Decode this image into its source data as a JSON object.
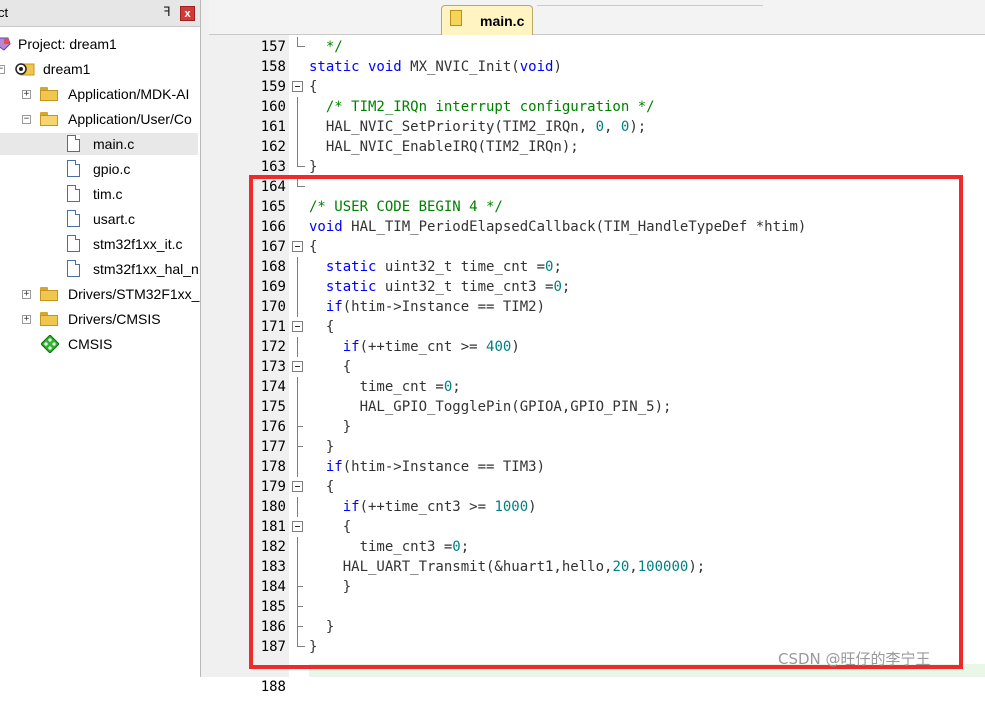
{
  "project_panel": {
    "title": "ct",
    "pin_glyph": "ꟻ",
    "close_glyph": "x",
    "tree": [
      {
        "label": "Project: dream1",
        "icon": "project-icon"
      },
      {
        "label": "dream1",
        "icon": "target-icon",
        "expander": "−"
      },
      {
        "label": "Application/MDK-AI",
        "icon": "folder-icon",
        "expander": "+"
      },
      {
        "label": "Application/User/Co",
        "icon": "folder-open-icon",
        "expander": "−"
      },
      {
        "label": "main.c",
        "icon": "file-icon"
      },
      {
        "label": "gpio.c",
        "icon": "file-icon"
      },
      {
        "label": "tim.c",
        "icon": "file-icon"
      },
      {
        "label": "usart.c",
        "icon": "file-icon"
      },
      {
        "label": "stm32f1xx_it.c",
        "icon": "file-icon"
      },
      {
        "label": "stm32f1xx_hal_n",
        "icon": "file-icon"
      },
      {
        "label": "Drivers/STM32F1xx_",
        "icon": "folder-icon",
        "expander": "+"
      },
      {
        "label": "Drivers/CMSIS",
        "icon": "folder-icon",
        "expander": "+"
      },
      {
        "label": "CMSIS",
        "icon": "cmsis-diamond-icon"
      }
    ]
  },
  "editor": {
    "active_tab": "main.c",
    "lines": [
      {
        "n": "157",
        "fold": "end"
      },
      {
        "n": "158",
        "fold": ""
      },
      {
        "n": "159",
        "fold": "box"
      },
      {
        "n": "160",
        "fold": "line"
      },
      {
        "n": "161",
        "fold": "line"
      },
      {
        "n": "162",
        "fold": "line"
      },
      {
        "n": "163",
        "fold": "end"
      },
      {
        "n": "164",
        "fold": "end"
      },
      {
        "n": "165",
        "fold": ""
      },
      {
        "n": "166",
        "fold": ""
      },
      {
        "n": "167",
        "fold": "box"
      },
      {
        "n": "168",
        "fold": "line"
      },
      {
        "n": "169",
        "fold": "line"
      },
      {
        "n": "170",
        "fold": "line"
      },
      {
        "n": "171",
        "fold": "box"
      },
      {
        "n": "172",
        "fold": "line"
      },
      {
        "n": "173",
        "fold": "box"
      },
      {
        "n": "174",
        "fold": "line"
      },
      {
        "n": "175",
        "fold": "line"
      },
      {
        "n": "176",
        "fold": "tick"
      },
      {
        "n": "177",
        "fold": "tick"
      },
      {
        "n": "178",
        "fold": "line"
      },
      {
        "n": "179",
        "fold": "box"
      },
      {
        "n": "180",
        "fold": "line"
      },
      {
        "n": "181",
        "fold": "box"
      },
      {
        "n": "182",
        "fold": "line"
      },
      {
        "n": "183",
        "fold": "line"
      },
      {
        "n": "184",
        "fold": "tick"
      },
      {
        "n": "185",
        "fold": "tick"
      },
      {
        "n": "186",
        "fold": "tick"
      },
      {
        "n": "187",
        "fold": "end"
      }
    ],
    "code": [
      [
        {
          "t": "  */",
          "c": "cm"
        }
      ],
      [
        {
          "t": "static void",
          "c": "kw"
        },
        {
          "t": " MX_NVIC_Init("
        },
        {
          "t": "void",
          "c": "kw"
        },
        {
          "t": ")"
        }
      ],
      [
        {
          "t": "{"
        }
      ],
      [
        {
          "t": "  "
        },
        {
          "t": "/* TIM2_IRQn interrupt configuration */",
          "c": "cm"
        }
      ],
      [
        {
          "t": "  HAL_NVIC_SetPriority(TIM2_IRQn, "
        },
        {
          "t": "0",
          "c": "num"
        },
        {
          "t": ", "
        },
        {
          "t": "0",
          "c": "num"
        },
        {
          "t": ");"
        }
      ],
      [
        {
          "t": "  HAL_NVIC_EnableIRQ(TIM2_IRQn);"
        }
      ],
      [
        {
          "t": "}"
        }
      ],
      [
        {
          "t": ""
        }
      ],
      [
        {
          "t": "/* USER CODE BEGIN 4 */",
          "c": "cm"
        }
      ],
      [
        {
          "t": "void",
          "c": "kw"
        },
        {
          "t": " HAL_TIM_PeriodElapsedCallback(TIM_HandleTypeDef *htim)"
        }
      ],
      [
        {
          "t": "{"
        }
      ],
      [
        {
          "t": "  "
        },
        {
          "t": "static",
          "c": "kw"
        },
        {
          "t": " uint32_t time_cnt ="
        },
        {
          "t": "0",
          "c": "num"
        },
        {
          "t": ";"
        }
      ],
      [
        {
          "t": "  "
        },
        {
          "t": "static",
          "c": "kw"
        },
        {
          "t": " uint32_t time_cnt3 ="
        },
        {
          "t": "0",
          "c": "num"
        },
        {
          "t": ";"
        }
      ],
      [
        {
          "t": "  "
        },
        {
          "t": "if",
          "c": "kw"
        },
        {
          "t": "(htim->Instance == TIM2)"
        }
      ],
      [
        {
          "t": "  {"
        }
      ],
      [
        {
          "t": "    "
        },
        {
          "t": "if",
          "c": "kw"
        },
        {
          "t": "(++time_cnt >= "
        },
        {
          "t": "400",
          "c": "num"
        },
        {
          "t": ")"
        }
      ],
      [
        {
          "t": "    {"
        }
      ],
      [
        {
          "t": "      time_cnt ="
        },
        {
          "t": "0",
          "c": "num"
        },
        {
          "t": ";"
        }
      ],
      [
        {
          "t": "      HAL_GPIO_TogglePin(GPIOA,GPIO_PIN_5);"
        }
      ],
      [
        {
          "t": "    }"
        }
      ],
      [
        {
          "t": "  }"
        }
      ],
      [
        {
          "t": "  "
        },
        {
          "t": "if",
          "c": "kw"
        },
        {
          "t": "(htim->Instance == TIM3)"
        }
      ],
      [
        {
          "t": "  {"
        }
      ],
      [
        {
          "t": "    "
        },
        {
          "t": "if",
          "c": "kw"
        },
        {
          "t": "(++time_cnt3 >= "
        },
        {
          "t": "1000",
          "c": "num"
        },
        {
          "t": ")"
        }
      ],
      [
        {
          "t": "    {"
        }
      ],
      [
        {
          "t": "      time_cnt3 ="
        },
        {
          "t": "0",
          "c": "num"
        },
        {
          "t": ";"
        }
      ],
      [
        {
          "t": "    HAL_UART_Transmit(&huart1,hello,"
        },
        {
          "t": "20",
          "c": "num"
        },
        {
          "t": ","
        },
        {
          "t": "100000",
          "c": "num"
        },
        {
          "t": ");"
        }
      ],
      [
        {
          "t": "    }"
        }
      ],
      [
        {
          "t": ""
        }
      ],
      [
        {
          "t": "  }"
        }
      ],
      [
        {
          "t": "}"
        }
      ]
    ],
    "partial_line_number": "188"
  },
  "highlight_color": "#ee2a2a",
  "watermark": "CSDN @旺仔的李宁王"
}
